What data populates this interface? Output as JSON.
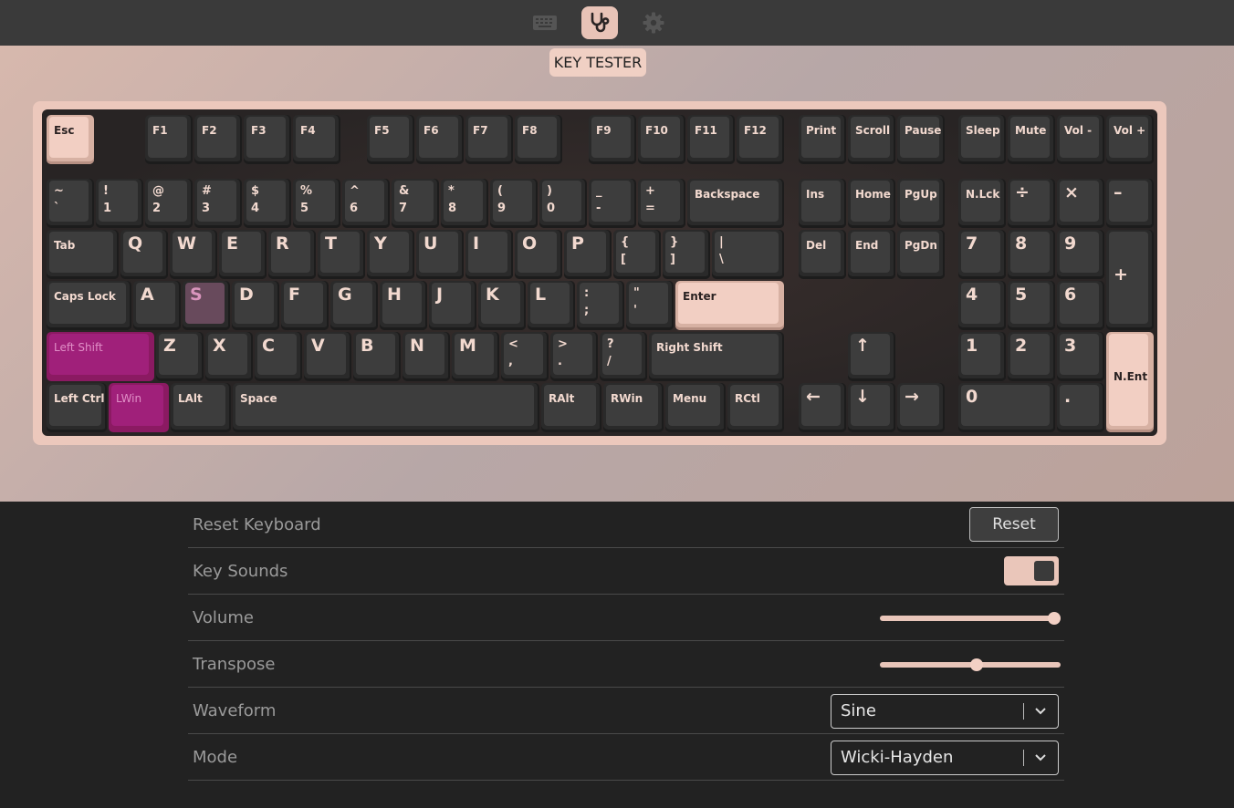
{
  "topbar": {
    "icons": [
      "keyboard-icon",
      "stethoscope-icon",
      "gear-icon"
    ],
    "active": "stethoscope-icon",
    "tooltip": "KEY TESTER"
  },
  "colors": {
    "accent": "#e8c3b7",
    "pressed_key": "#f2cfc3",
    "held_key": "#a0207a",
    "keycap": "#3d3d3d",
    "legend": "#f2d9cf"
  },
  "keyboard": {
    "keys": [
      {
        "id": "esc",
        "label": "Esc",
        "state": "pressed"
      },
      {
        "id": "f1",
        "label": "F1"
      },
      {
        "id": "f2",
        "label": "F2"
      },
      {
        "id": "f3",
        "label": "F3"
      },
      {
        "id": "f4",
        "label": "F4"
      },
      {
        "id": "f5",
        "label": "F5"
      },
      {
        "id": "f6",
        "label": "F6"
      },
      {
        "id": "f7",
        "label": "F7"
      },
      {
        "id": "f8",
        "label": "F8"
      },
      {
        "id": "f9",
        "label": "F9"
      },
      {
        "id": "f10",
        "label": "F10"
      },
      {
        "id": "f11",
        "label": "F11"
      },
      {
        "id": "f12",
        "label": "F12"
      },
      {
        "id": "print",
        "label": "Print"
      },
      {
        "id": "scroll",
        "label": "Scroll"
      },
      {
        "id": "pause",
        "label": "Pause"
      },
      {
        "id": "sleep",
        "label": "Sleep"
      },
      {
        "id": "mute",
        "label": "Mute"
      },
      {
        "id": "vol-down",
        "label": "Vol -"
      },
      {
        "id": "vol-up",
        "label": "Vol +"
      },
      {
        "id": "backtick",
        "label": "~\n`"
      },
      {
        "id": "1",
        "label": "!\n1"
      },
      {
        "id": "2",
        "label": "@\n2"
      },
      {
        "id": "3",
        "label": "#\n3"
      },
      {
        "id": "4",
        "label": "$\n4"
      },
      {
        "id": "5",
        "label": "%\n5"
      },
      {
        "id": "6",
        "label": "^\n6"
      },
      {
        "id": "7",
        "label": "&\n7"
      },
      {
        "id": "8",
        "label": "*\n8"
      },
      {
        "id": "9",
        "label": "(\n9"
      },
      {
        "id": "0",
        "label": ")\n0"
      },
      {
        "id": "minus",
        "label": "_\n-"
      },
      {
        "id": "equal",
        "label": "+\n="
      },
      {
        "id": "backspace",
        "label": "Backspace"
      },
      {
        "id": "ins",
        "label": "Ins"
      },
      {
        "id": "home",
        "label": "Home"
      },
      {
        "id": "pgup",
        "label": "PgUp"
      },
      {
        "id": "nlck",
        "label": "N.Lck"
      },
      {
        "id": "num-div",
        "label": "÷"
      },
      {
        "id": "num-mul",
        "label": "×"
      },
      {
        "id": "num-sub",
        "label": "–"
      },
      {
        "id": "tab",
        "label": "Tab"
      },
      {
        "id": "q",
        "label": "Q"
      },
      {
        "id": "w",
        "label": "W"
      },
      {
        "id": "e",
        "label": "E"
      },
      {
        "id": "r",
        "label": "R"
      },
      {
        "id": "t",
        "label": "T"
      },
      {
        "id": "y",
        "label": "Y"
      },
      {
        "id": "u",
        "label": "U"
      },
      {
        "id": "i",
        "label": "I"
      },
      {
        "id": "o",
        "label": "O"
      },
      {
        "id": "p",
        "label": "P"
      },
      {
        "id": "lbracket",
        "label": "{\n["
      },
      {
        "id": "rbracket",
        "label": "}\n]"
      },
      {
        "id": "backslash",
        "label": "|\n\\"
      },
      {
        "id": "del",
        "label": "Del"
      },
      {
        "id": "end",
        "label": "End"
      },
      {
        "id": "pgdn",
        "label": "PgDn"
      },
      {
        "id": "num7",
        "label": "7"
      },
      {
        "id": "num8",
        "label": "8"
      },
      {
        "id": "num9",
        "label": "9"
      },
      {
        "id": "num-add",
        "label": "+"
      },
      {
        "id": "capslock",
        "label": "Caps Lock"
      },
      {
        "id": "a",
        "label": "A"
      },
      {
        "id": "s",
        "label": "S",
        "state": "held"
      },
      {
        "id": "d",
        "label": "D"
      },
      {
        "id": "f",
        "label": "F"
      },
      {
        "id": "g",
        "label": "G"
      },
      {
        "id": "h",
        "label": "H"
      },
      {
        "id": "j",
        "label": "J"
      },
      {
        "id": "k",
        "label": "K"
      },
      {
        "id": "l",
        "label": "L"
      },
      {
        "id": "semicolon",
        "label": ":\n;"
      },
      {
        "id": "quote",
        "label": "\"\n'"
      },
      {
        "id": "enter",
        "label": "Enter",
        "state": "pressed"
      },
      {
        "id": "num4",
        "label": "4"
      },
      {
        "id": "num5",
        "label": "5"
      },
      {
        "id": "num6",
        "label": "6"
      },
      {
        "id": "lshift",
        "label": "Left Shift",
        "state": "active"
      },
      {
        "id": "z",
        "label": "Z"
      },
      {
        "id": "x",
        "label": "X"
      },
      {
        "id": "c",
        "label": "C"
      },
      {
        "id": "v",
        "label": "V"
      },
      {
        "id": "b",
        "label": "B"
      },
      {
        "id": "n",
        "label": "N"
      },
      {
        "id": "m",
        "label": "M"
      },
      {
        "id": "comma",
        "label": "<\n,"
      },
      {
        "id": "period",
        "label": ">\n."
      },
      {
        "id": "slash",
        "label": "?\n/"
      },
      {
        "id": "rshift",
        "label": "Right Shift"
      },
      {
        "id": "up",
        "label": "↑"
      },
      {
        "id": "num1",
        "label": "1"
      },
      {
        "id": "num2",
        "label": "2"
      },
      {
        "id": "num3",
        "label": "3"
      },
      {
        "id": "num-enter",
        "label": "N.Ent",
        "state": "pressed"
      },
      {
        "id": "lctrl",
        "label": "Left Ctrl"
      },
      {
        "id": "lwin",
        "label": "LWin",
        "state": "active"
      },
      {
        "id": "lalt",
        "label": "LAlt"
      },
      {
        "id": "space",
        "label": "Space"
      },
      {
        "id": "ralt",
        "label": "RAlt"
      },
      {
        "id": "rwin",
        "label": "RWin"
      },
      {
        "id": "menu",
        "label": "Menu"
      },
      {
        "id": "rctl",
        "label": "RCtl"
      },
      {
        "id": "left",
        "label": "←"
      },
      {
        "id": "down",
        "label": "↓"
      },
      {
        "id": "right",
        "label": "→"
      },
      {
        "id": "num0",
        "label": "0"
      },
      {
        "id": "num-dot",
        "label": "."
      }
    ]
  },
  "settings": {
    "reset_label": "Reset Keyboard",
    "reset_button": "Reset",
    "sounds_label": "Key Sounds",
    "sounds_on": true,
    "volume_label": "Volume",
    "volume": 1.0,
    "transpose_label": "Transpose",
    "transpose": 0.5,
    "waveform_label": "Waveform",
    "waveform": "Sine",
    "mode_label": "Mode",
    "mode": "Wicki-Hayden"
  }
}
